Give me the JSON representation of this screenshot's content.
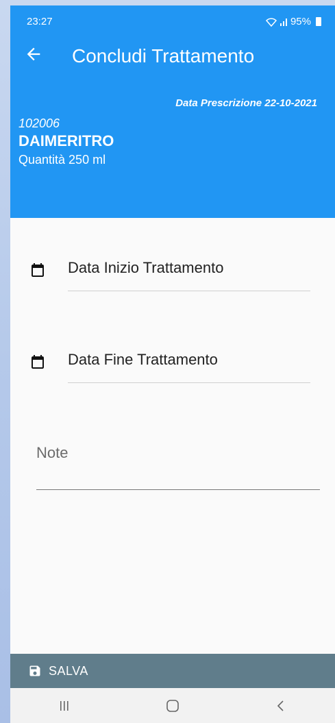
{
  "status_bar": {
    "time": "23:27",
    "battery": "95%"
  },
  "header": {
    "title": "Concludi Trattamento",
    "prescription_date": "Data Prescrizione 22-10-2021",
    "code": "102006",
    "drug_name": "DAIMERITRO",
    "quantity": "Quantità 250 ml",
    "color": "#2196f3"
  },
  "form": {
    "start_date_label": "Data Inizio Trattamento",
    "end_date_label": "Data Fine Trattamento",
    "note_label": "Note"
  },
  "actions": {
    "save_label": "SALVA",
    "bar_color": "#607d8b"
  },
  "icons": {
    "back": "arrow-left-icon",
    "calendar": "calendar-icon",
    "save": "floppy-disk-icon"
  }
}
